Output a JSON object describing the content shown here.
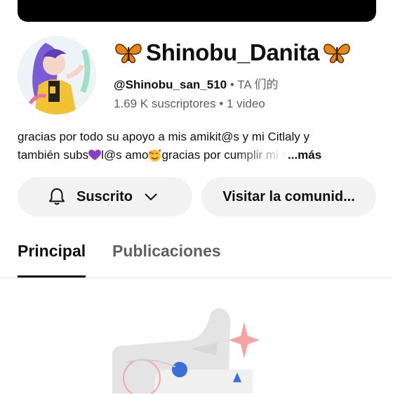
{
  "channel": {
    "name": "Shinobu_Danita",
    "handle": "@Shinobu_san_510",
    "separator": "•",
    "tag": "TA 们的",
    "subscribers": "1.69 K suscriptores",
    "videos": "1 video",
    "description_line1": "gracias por todo su apoyo a mis amikit@s y mi Citlaly y",
    "description_line2_a": "también subs",
    "description_line2_b": " l@s amo",
    "description_line2_c": " gracias por cumplir mi s",
    "more": "...más"
  },
  "actions": {
    "subscribed_label": "Suscrito",
    "community_label": "Visitar la comunid..."
  },
  "tabs": [
    {
      "label": "Principal",
      "active": true
    },
    {
      "label": "Publicaciones",
      "active": false
    }
  ],
  "colors": {
    "text": "#0f0f0f",
    "secondary_text": "#606060",
    "button_bg": "#f2f2f2",
    "accent_butterfly": "#e8841a"
  },
  "icons": {
    "bell": "bell-icon",
    "chevron": "chevron-down-icon",
    "butterfly": "butterfly-emoji",
    "heart": "purple-heart-emoji",
    "smile": "smiling-face-with-hearts-emoji"
  }
}
